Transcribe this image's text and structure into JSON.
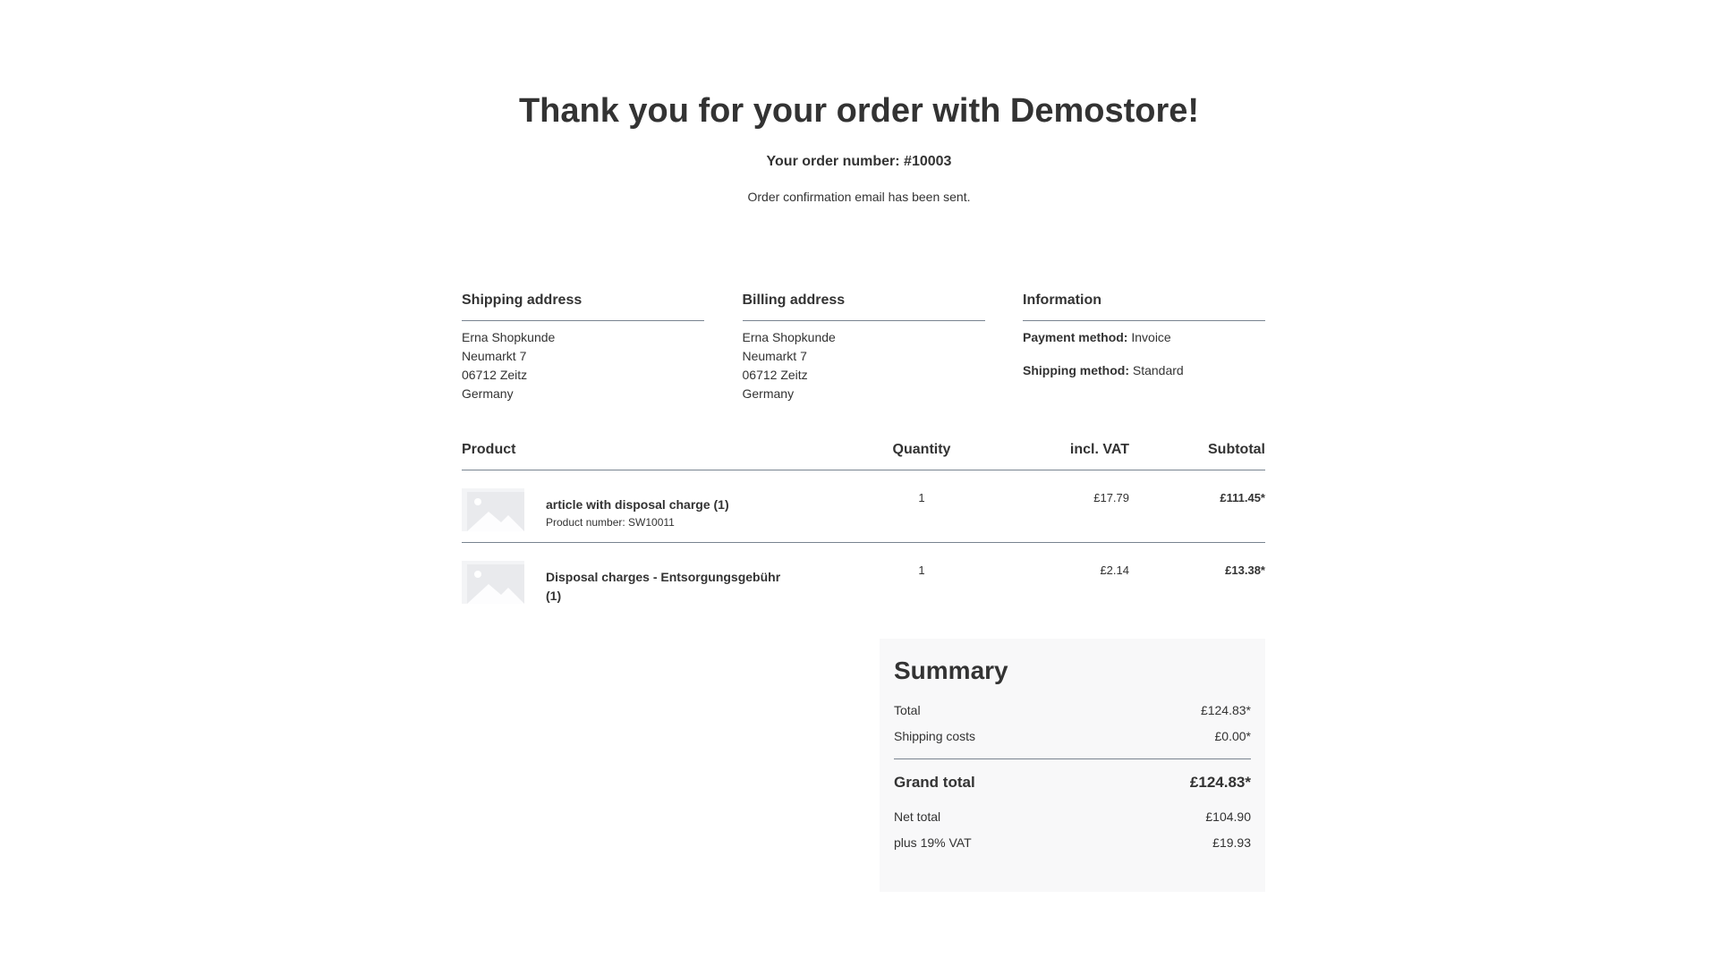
{
  "header": {
    "title": "Thank you for your order with Demostore!",
    "order_number_line": "Your order number: #10003",
    "confirmation_text": "Order confirmation email has been sent."
  },
  "shipping_address": {
    "title": "Shipping address",
    "name": "Erna Shopkunde",
    "street": "Neumarkt 7",
    "city": "06712 Zeitz",
    "country": "Germany"
  },
  "billing_address": {
    "title": "Billing address",
    "name": "Erna Shopkunde",
    "street": "Neumarkt 7",
    "city": "06712 Zeitz",
    "country": "Germany"
  },
  "information": {
    "title": "Information",
    "payment_label": "Payment method:",
    "payment_value": "Invoice",
    "shipping_label": "Shipping method:",
    "shipping_value": "Standard"
  },
  "table": {
    "headers": {
      "product": "Product",
      "quantity": "Quantity",
      "price": "incl. VAT",
      "subtotal": "Subtotal"
    },
    "rows": [
      {
        "name": "article with disposal charge (1)",
        "product_number": "Product number: SW10011",
        "quantity": "1",
        "price": "£17.79",
        "subtotal": "£111.45*"
      },
      {
        "name": "Disposal charges - Entsorgungsgebühr (1)",
        "quantity": "1",
        "price": "£2.14",
        "subtotal": "£13.38*"
      }
    ]
  },
  "summary": {
    "title": "Summary",
    "total_label": "Total",
    "total_value": "£124.83*",
    "shipping_label": "Shipping costs",
    "shipping_value": "£0.00*",
    "grand_total_label": "Grand total",
    "grand_total_value": "£124.83*",
    "net_label": "Net total",
    "net_value": "£104.90",
    "vat_label": "plus 19% VAT",
    "vat_value": "£19.93"
  },
  "colors": {
    "text": "#333333",
    "divider": "#798490",
    "summary_bg": "#f8f8f9",
    "placeholder": "#e9eaed"
  },
  "icons": {
    "product_placeholder": "placeholder-image-icon"
  }
}
